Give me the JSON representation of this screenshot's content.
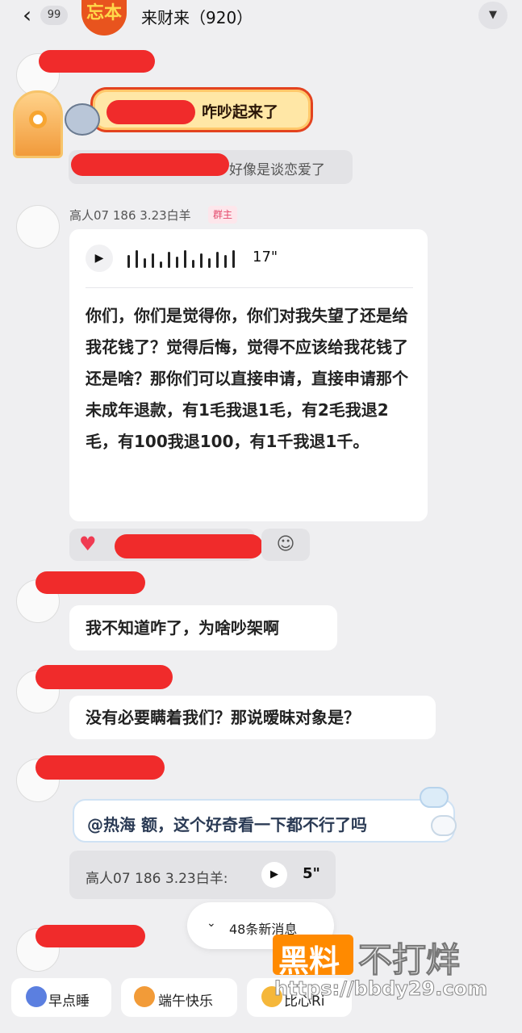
{
  "header": {
    "back_icon": "chevron-left-icon",
    "unread_count": "99",
    "group_avatar_text": "忘本",
    "group_title": "来财来（920）",
    "menu_icon": "chevron-down-icon"
  },
  "messages": {
    "join_notice": "咋吵起来了",
    "reply_hint": "好像是谈恋爱了",
    "owner_message": {
      "sender": "高人07  186  3.23白羊",
      "badge": "群主",
      "voice_duration": "17\"",
      "transcript": "你们，你们是觉得你，你们对我失望了还是给我花钱了？觉得后悔，觉得不应该给我花钱了还是啥？那你们可以直接申请，直接申请那个未成年退款，有1毛我退1毛，有2毛我退2毛，有100我退100，有1千我退1千。"
    },
    "msg_1": "我不知道咋了，为啥吵架啊",
    "msg_2": "没有必要瞒着我们？那说暧昧对象是？",
    "msg_3": {
      "mention": "@热海",
      "text": "额，这个好奇看一下都不行了吗"
    },
    "quote": {
      "text": "高人07  186  3.23白羊:",
      "duration": "5\""
    }
  },
  "new_messages": {
    "icon": "double-chevron-down-icon",
    "label": "48条新消息"
  },
  "quick_replies": [
    {
      "label": "早点睡",
      "icon": "moon-icon"
    },
    {
      "label": "端午快乐",
      "icon": "dragon-icon"
    },
    {
      "label": "比心Ri",
      "icon": "heart-hand-icon"
    }
  ],
  "watermark": {
    "box_text": "黑料",
    "text": "不打烊",
    "url": "https://bbdy29.com"
  },
  "colors": {
    "background": "#efeff1",
    "bubble": "#ffffff",
    "redaction": "#f02b2b",
    "owner_badge": "#e4496b",
    "heart": "#f03b52"
  }
}
